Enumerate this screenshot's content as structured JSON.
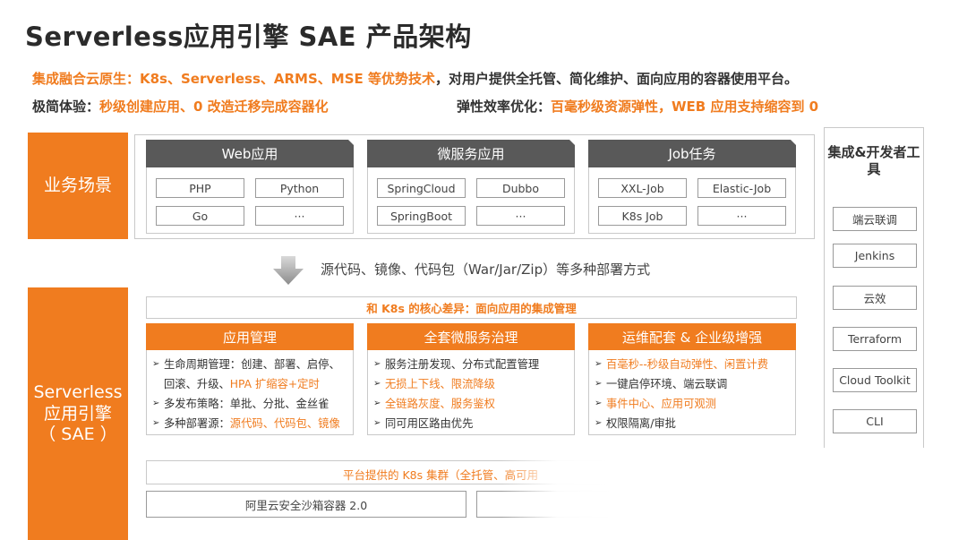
{
  "title": "Serverless应用引擎 SAE 产品架构",
  "intro": {
    "line1_highlight": "集成融合云原生：K8s、Serverless、ARMS、MSE 等优势技术",
    "line1_rest": "，对用户提供全托管、简化维护、面向应用的容器使用平台。",
    "line2a_label": "极简体验：",
    "line2a_value": "秒级创建应用、0 改造迁移完成容器化",
    "line2b_label": "弹性效率优化：",
    "line2b_value": "百毫秒级资源弹性，WEB 应用支持缩容到 0"
  },
  "scenario": {
    "label": "业务场景",
    "panels": [
      {
        "title": "Web应用",
        "items": [
          "PHP",
          "Python",
          "Go",
          "···"
        ]
      },
      {
        "title": "微服务应用",
        "items": [
          "SpringCloud",
          "Dubbo",
          "SpringBoot",
          "···"
        ]
      },
      {
        "title": "Job任务",
        "items": [
          "XXL-Job",
          "Elastic-Job",
          "K8s Job",
          "···"
        ]
      }
    ]
  },
  "deploy_text": "源代码、镜像、代码包（War/Jar/Zip）等多种部署方式",
  "sae": {
    "label_line1": "Serverless",
    "label_line2": "应用引擎",
    "label_line3": "（ SAE ）",
    "diff_bar": "和 K8s 的核心差异：面向应用的集成管理",
    "columns": [
      {
        "title": "应用管理",
        "b1_text": "生命周期管理：创建、部署、启停、",
        "b1_cont": "回滚、升级、",
        "b1_hl": "HPA 扩缩容+定时",
        "b2_text": "多发布策略：单批、分批、金丝雀",
        "b3_text": "多种部署源：",
        "b3_hl": "源代码、代码包、镜像"
      },
      {
        "title": "全套微服务治理",
        "b1_text": "服务注册发现、分布式配置管理",
        "b2_hl": "无损上下线、限流降级",
        "b3_hl": "全链路灰度、服务鉴权",
        "b4_text": "同可用区路由优先"
      },
      {
        "title": "运维配套 & 企业级增强",
        "b1_hl": "百毫秒--秒级自动弹性、闲置计费",
        "b2_text": "一键启停环境、端云联调",
        "b3_hl": "事件中心、应用可观测",
        "b4_text": "权限隔离/审批"
      }
    ],
    "k8s_bar": "平台提供的 K8s 集群（全托管、高可用",
    "sandbox": "阿里云安全沙箱容器 2.0"
  },
  "tools": {
    "title": "集成&开发者工具",
    "items": [
      "端云联调",
      "Jenkins",
      "云效",
      "Terraform",
      "Cloud Toolkit",
      "CLI"
    ]
  },
  "colors": {
    "accent": "#f07c1f",
    "panel_head": "#595959"
  }
}
